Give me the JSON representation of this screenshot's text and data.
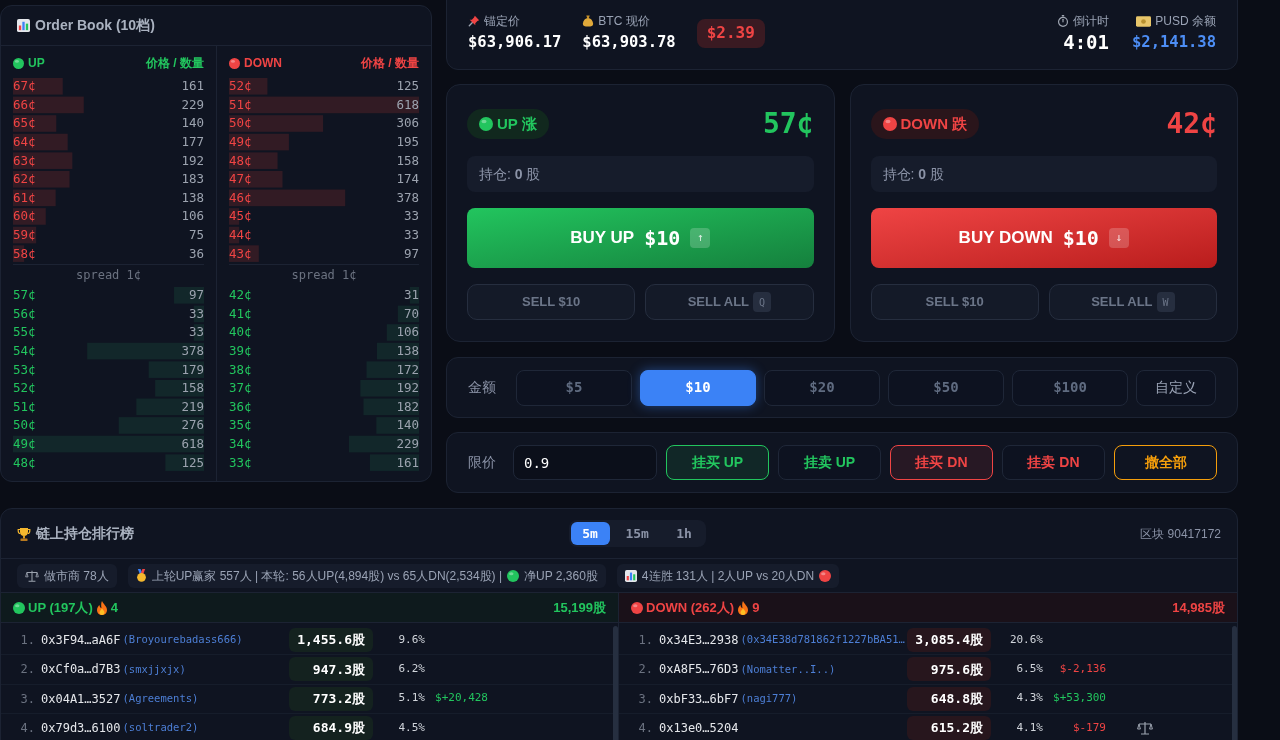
{
  "order_book": {
    "title": "Order Book (10档)",
    "sides": [
      {
        "kind": "up",
        "label": "UP",
        "header": "价格 / 数量",
        "asks": [
          {
            "price": "67¢",
            "qty": "161"
          },
          {
            "price": "66¢",
            "qty": "229"
          },
          {
            "price": "65¢",
            "qty": "140"
          },
          {
            "price": "64¢",
            "qty": "177"
          },
          {
            "price": "63¢",
            "qty": "192"
          },
          {
            "price": "62¢",
            "qty": "183"
          },
          {
            "price": "61¢",
            "qty": "138"
          },
          {
            "price": "60¢",
            "qty": "106"
          },
          {
            "price": "59¢",
            "qty": "75"
          },
          {
            "price": "58¢",
            "qty": "36"
          }
        ],
        "spread": "spread 1¢",
        "bids": [
          {
            "price": "57¢",
            "qty": "97"
          },
          {
            "price": "56¢",
            "qty": "33"
          },
          {
            "price": "55¢",
            "qty": "33"
          },
          {
            "price": "54¢",
            "qty": "378"
          },
          {
            "price": "53¢",
            "qty": "179"
          },
          {
            "price": "52¢",
            "qty": "158"
          },
          {
            "price": "51¢",
            "qty": "219"
          },
          {
            "price": "50¢",
            "qty": "276"
          },
          {
            "price": "49¢",
            "qty": "618"
          },
          {
            "price": "48¢",
            "qty": "125"
          }
        ]
      },
      {
        "kind": "down",
        "label": "DOWN",
        "header": "价格 / 数量",
        "asks": [
          {
            "price": "52¢",
            "qty": "125"
          },
          {
            "price": "51¢",
            "qty": "618"
          },
          {
            "price": "50¢",
            "qty": "306"
          },
          {
            "price": "49¢",
            "qty": "195"
          },
          {
            "price": "48¢",
            "qty": "158"
          },
          {
            "price": "47¢",
            "qty": "174"
          },
          {
            "price": "46¢",
            "qty": "378"
          },
          {
            "price": "45¢",
            "qty": "33"
          },
          {
            "price": "44¢",
            "qty": "33"
          },
          {
            "price": "43¢",
            "qty": "97"
          }
        ],
        "spread": "spread 1¢",
        "bids": [
          {
            "price": "42¢",
            "qty": "31"
          },
          {
            "price": "41¢",
            "qty": "70"
          },
          {
            "price": "40¢",
            "qty": "106"
          },
          {
            "price": "39¢",
            "qty": "138"
          },
          {
            "price": "38¢",
            "qty": "172"
          },
          {
            "price": "37¢",
            "qty": "192"
          },
          {
            "price": "36¢",
            "qty": "182"
          },
          {
            "price": "35¢",
            "qty": "140"
          },
          {
            "price": "34¢",
            "qty": "229"
          },
          {
            "price": "33¢",
            "qty": "161"
          }
        ]
      }
    ]
  },
  "stats": {
    "items": [
      {
        "kind": "anchor",
        "label": "锚定价",
        "value": "$63,906.17"
      },
      {
        "kind": "btc",
        "label": "BTC 现价",
        "value": "$63,903.78"
      }
    ],
    "diff": "$2.39",
    "right_items": [
      {
        "kind": "countdown",
        "label": "倒计时",
        "value": "4:01"
      },
      {
        "kind": "balance",
        "label": "PUSD 余额",
        "value": "$2,141.38"
      }
    ]
  },
  "trade_cards": [
    {
      "kind": "up",
      "badge": "UP 涨",
      "price": "57¢",
      "position": "持仓: **0** 股",
      "buy_label": "BUY UP",
      "buy_amount": "$10",
      "buy_key": "↑",
      "sell_buttons": [
        {
          "label": "SELL $10"
        },
        {
          "label": "SELL ALL",
          "key": "Q"
        }
      ]
    },
    {
      "kind": "down",
      "badge": "DOWN 跌",
      "price": "42¢",
      "position": "持仓: **0** 股",
      "buy_label": "BUY DOWN",
      "buy_amount": "$10",
      "buy_key": "↓",
      "sell_buttons": [
        {
          "label": "SELL $10"
        },
        {
          "label": "SELL ALL",
          "key": "W"
        }
      ]
    }
  ],
  "amount": {
    "label": "金额",
    "options": [
      {
        "label": "$5",
        "kind": "preset",
        "selected": false
      },
      {
        "label": "$10",
        "kind": "preset",
        "selected": true
      },
      {
        "label": "$20",
        "kind": "preset",
        "selected": false
      },
      {
        "label": "$50",
        "kind": "preset",
        "selected": false
      },
      {
        "label": "$100",
        "kind": "preset",
        "selected": false
      },
      {
        "label": "自定义",
        "kind": "custom",
        "selected": false
      }
    ]
  },
  "limit": {
    "label": "限价",
    "value": "0.9",
    "buttons": [
      {
        "label": "挂买 UP",
        "kind": "buy",
        "color": "#22c55e"
      },
      {
        "label": "挂卖 UP",
        "kind": "sell",
        "color": "#22c55e"
      },
      {
        "label": "挂买 DN",
        "kind": "buy",
        "color": "#ef4444"
      },
      {
        "label": "挂卖 DN",
        "kind": "sell",
        "color": "#ef4444"
      },
      {
        "label": "撤全部",
        "kind": "cancel",
        "color": "#f59e0b"
      }
    ]
  },
  "leaderboard": {
    "title": "链上持仓排行榜",
    "tabs": [
      {
        "label": "5m",
        "selected": true
      },
      {
        "label": "15m",
        "selected": false
      },
      {
        "label": "1h",
        "selected": false
      }
    ],
    "block": "区块 90417172",
    "chips": [
      {
        "kind": "market_maker",
        "text": "做市商 78人"
      },
      {
        "kind": "winners",
        "text": "上轮UP赢家 557人 | 本轮: 56人UP(4,894股) vs 65人DN(2,534股) |",
        "note": "净UP 2,360股"
      },
      {
        "kind": "streak",
        "text": "4连胜 131人 | 2人UP vs 20人DN"
      }
    ],
    "sides": [
      {
        "kind": "up",
        "title": "UP (197人)",
        "streak": "4",
        "total": "15,199股",
        "rows": [
          {
            "rank": "1.",
            "address": "0x3F94…aA6F",
            "name": "(Broyourebadass666)",
            "shares": "1,455.6股",
            "pct": "9.6%",
            "market_maker": false
          },
          {
            "rank": "2.",
            "address": "0xCf0a…d7B3",
            "name": "(smxjjxjx)",
            "shares": "947.3股",
            "pct": "6.2%",
            "market_maker": false
          },
          {
            "rank": "3.",
            "address": "0x04A1…3527",
            "name": "(Agreements)",
            "shares": "773.2股",
            "pct": "5.1%",
            "pnl": {
              "text": "$+20,428",
              "kind": "gain"
            },
            "market_maker": false
          },
          {
            "rank": "4.",
            "address": "0x79d3…6100",
            "name": "(soltrader2)",
            "shares": "684.9股",
            "pct": "4.5%",
            "market_maker": false
          }
        ]
      },
      {
        "kind": "down",
        "title": "DOWN (262人)",
        "streak": "9",
        "total": "14,985股",
        "rows": [
          {
            "rank": "1.",
            "address": "0x34E3…2938",
            "name": "(0x34E38d781862f1227bBA51…",
            "shares": "3,085.4股",
            "pct": "20.6%",
            "market_maker": false
          },
          {
            "rank": "2.",
            "address": "0xA8F5…76D3",
            "name": "(Nomatter..I..)",
            "shares": "975.6股",
            "pct": "6.5%",
            "pnl": {
              "text": "$-2,136",
              "kind": "loss"
            },
            "market_maker": false
          },
          {
            "rank": "3.",
            "address": "0xbF33…6bF7",
            "name": "(nagi777)",
            "shares": "648.8股",
            "pct": "4.3%",
            "pnl": {
              "text": "$+53,300",
              "kind": "gain"
            },
            "market_maker": false
          },
          {
            "rank": "4.",
            "address": "0x13e0…5204",
            "shares": "615.2股",
            "pct": "4.1%",
            "pnl": {
              "text": "$-179",
              "kind": "loss"
            },
            "market_maker": true
          }
        ]
      }
    ]
  }
}
